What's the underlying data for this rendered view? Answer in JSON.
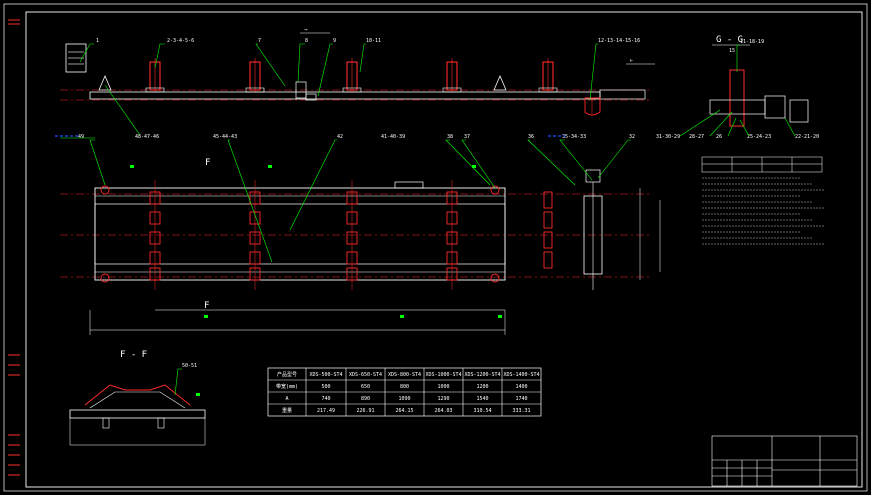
{
  "callouts_top": [
    "1",
    "2-3-4-5-6",
    "7",
    "8",
    "9",
    "10-11",
    "12-13-14-15-16"
  ],
  "callouts_mid": [
    "49",
    "48-47-46",
    "45-44-43",
    "42",
    "41-40-39",
    "38",
    "37",
    "36",
    "35-34-33",
    "32"
  ],
  "callouts_side": [
    "11-18-19",
    "31-30-29",
    "28-27",
    "26",
    "25-24-23",
    "22-21-20"
  ],
  "section_labels": {
    "ff_plan": "F",
    "ff_view": "F - F",
    "gg_view": "G - G",
    "gg_scale": "15"
  },
  "ff_callout": "50-51",
  "table": {
    "headers": [
      "产品型号",
      "XDS-500-ST4",
      "XDS-650-ST4",
      "XDS-800-ST4",
      "XDS-1000-ST4",
      "XDS-1200-ST4",
      "XDS-1400-ST4"
    ],
    "rows": [
      [
        "带宽(mm)",
        "500",
        "650",
        "800",
        "1000",
        "1200",
        "1400"
      ],
      [
        "A",
        "740",
        "890",
        "1090",
        "1290",
        "1540",
        "1740"
      ],
      [
        "重量",
        "217.49",
        "226.91",
        "264.15",
        "264.03",
        "310.54",
        "333.31"
      ]
    ]
  },
  "colors": {
    "red": "#ff2a2a",
    "green": "#00ff00",
    "blue": "#1e4fff",
    "white": "#ffffff",
    "cyan": "#00ffff",
    "yellow": "#ffff00"
  }
}
